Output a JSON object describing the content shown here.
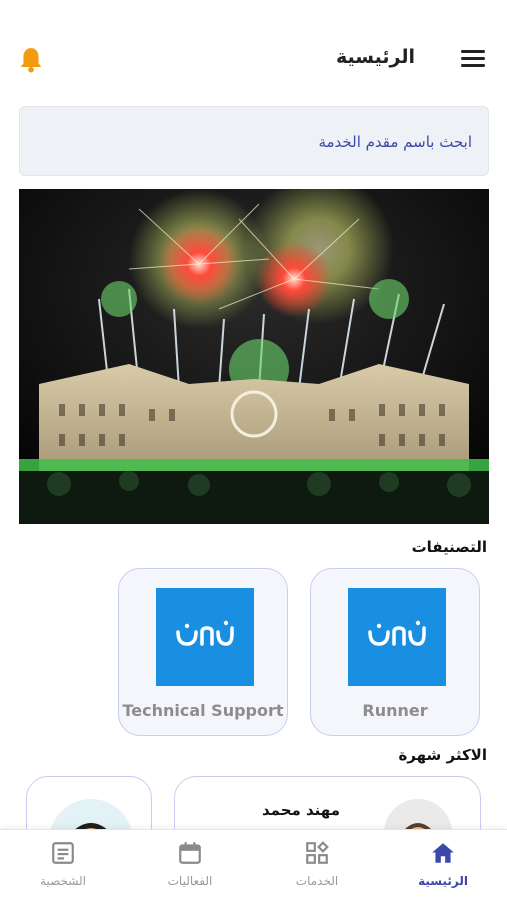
{
  "header": {
    "title": "الرئيسية",
    "bell_icon": "bell-icon",
    "menu_icon": "hamburger-menu-icon",
    "accent_color": "#f39c12"
  },
  "search": {
    "placeholder": "ابحث باسم مقدم الخدمة"
  },
  "banner": {
    "image": "fireworks-over-building"
  },
  "categories": {
    "title": "التصنيفات",
    "items": [
      {
        "label": "Runner",
        "logo_text": "نفدن"
      },
      {
        "label": "Technical Support",
        "logo_text": "نفدن"
      }
    ]
  },
  "popular": {
    "title": "الاكثر شهرة",
    "items": [
      {
        "name": "مهند محمد"
      }
    ]
  },
  "bottom_nav": {
    "items": [
      {
        "label": "الرئيسية",
        "icon": "home-icon",
        "active": true
      },
      {
        "label": "الخدمات",
        "icon": "grid-icon",
        "active": false
      },
      {
        "label": "الفعاليات",
        "icon": "calendar-icon",
        "active": false
      },
      {
        "label": "الشخصية",
        "icon": "profile-icon",
        "active": false
      }
    ],
    "active_color": "#3b49a8"
  }
}
